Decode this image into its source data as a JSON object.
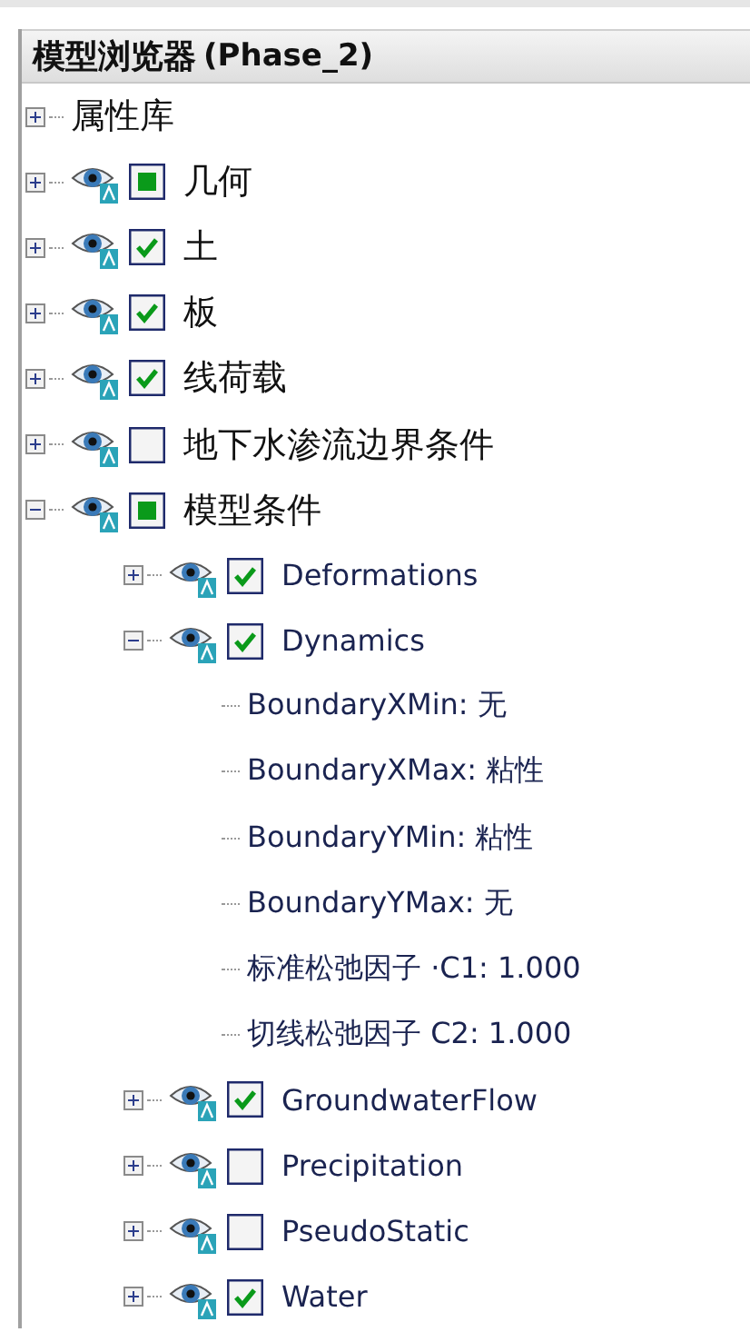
{
  "panel": {
    "title": "模型浏览器",
    "phase": "(Phase_2)"
  },
  "tree": [
    {
      "kind": "folder",
      "label": "属性库",
      "expanded": false
    },
    {
      "kind": "layer",
      "label": "几何",
      "expanded": false,
      "checked": false,
      "partial": true
    },
    {
      "kind": "layer",
      "label": "土",
      "expanded": false,
      "checked": true,
      "partial": false
    },
    {
      "kind": "layer",
      "label": "板",
      "expanded": false,
      "checked": true,
      "partial": false
    },
    {
      "kind": "layer",
      "label": "线荷载",
      "expanded": false,
      "checked": true,
      "partial": false
    },
    {
      "kind": "layer",
      "label": "地下水渗流边界条件",
      "expanded": false,
      "checked": false,
      "partial": false
    },
    {
      "kind": "layer",
      "label": "模型条件",
      "expanded": true,
      "checked": false,
      "partial": true,
      "children": [
        {
          "kind": "layer",
          "label": "Deformations",
          "expanded": false,
          "checked": true,
          "partial": false
        },
        {
          "kind": "layer",
          "label": "Dynamics",
          "expanded": true,
          "checked": true,
          "partial": false,
          "children": [
            {
              "kind": "property",
              "label": "BoundaryXMin: 无"
            },
            {
              "kind": "property",
              "label": "BoundaryXMax: 粘性"
            },
            {
              "kind": "property",
              "label": "BoundaryYMin: 粘性"
            },
            {
              "kind": "property",
              "label": "BoundaryYMax: 无"
            },
            {
              "kind": "property",
              "label": "标准松弛因子 ·C1: 1.000"
            },
            {
              "kind": "property",
              "label": "切线松弛因子 C2: 1.000"
            }
          ]
        },
        {
          "kind": "layer",
          "label": "GroundwaterFlow",
          "expanded": false,
          "checked": true,
          "partial": false
        },
        {
          "kind": "layer",
          "label": "Precipitation",
          "expanded": false,
          "checked": false,
          "partial": false
        },
        {
          "kind": "layer",
          "label": "PseudoStatic",
          "expanded": false,
          "checked": false,
          "partial": false
        },
        {
          "kind": "layer",
          "label": "Water",
          "expanded": false,
          "checked": true,
          "partial": false
        }
      ]
    }
  ]
}
